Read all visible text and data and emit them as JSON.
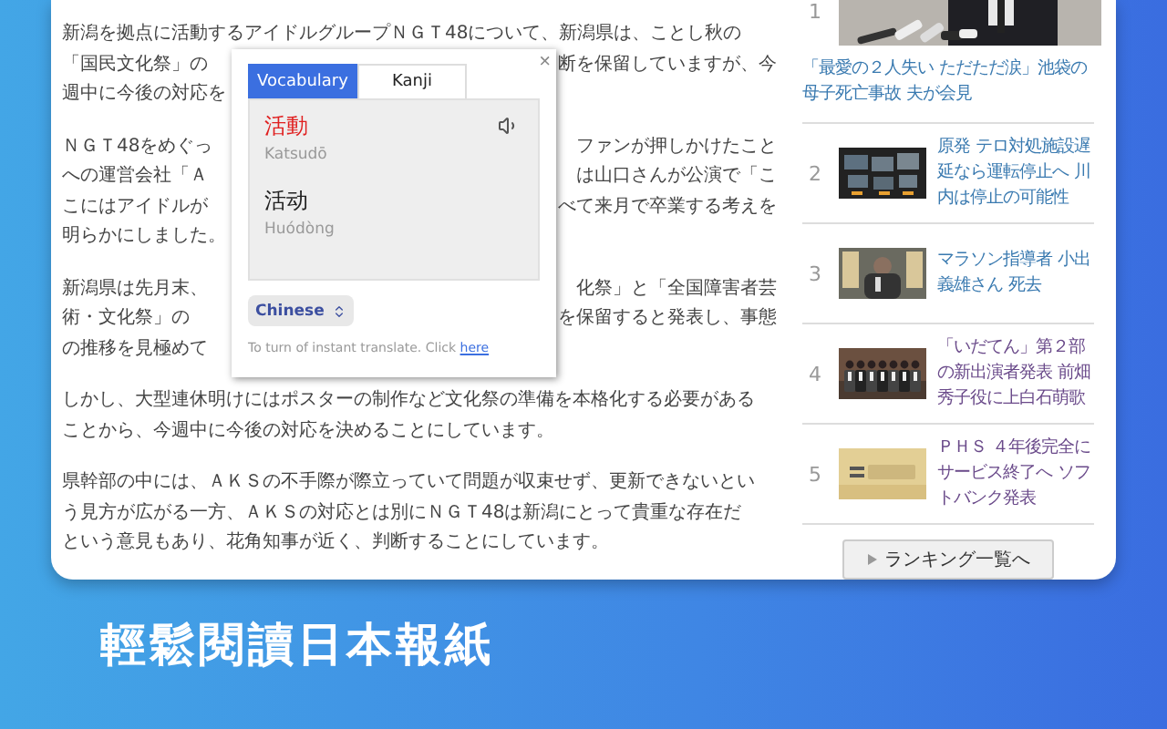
{
  "article": {
    "paragraphs": [
      {
        "lines": [
          {
            "left": "新潟を拠点に活動するアイドルグループＮＧＴ48について、新潟県は、ことし秋の"
          },
          {
            "left": "「国民文化祭」の",
            "right": "断を保留していますが、今"
          },
          {
            "left": "週中に今後の対応を"
          }
        ]
      },
      {
        "lines": [
          {
            "left": "ＮＧＴ48をめぐっ",
            "right": "ファンが押しかけたこと"
          },
          {
            "left": "への運営会社「Ａ",
            "right": "は山口さんが公演で「こ"
          },
          {
            "left": "こにはアイドルが",
            "right": "べて来月で卒業する考えを"
          },
          {
            "left": "明らかにしました。"
          }
        ]
      },
      {
        "lines": [
          {
            "left": "新潟県は先月末、",
            "right": "化祭」と「全国障害者芸"
          },
          {
            "left": "術・文化祭」の",
            "right": "を保留すると発表し、事態"
          },
          {
            "left": "の推移を見極めて"
          }
        ]
      },
      {
        "lines": [
          {
            "left": "しかし、大型連休明けにはポスターの制作など文化祭の準備を本格化する必要がある"
          },
          {
            "left": "ことから、今週中に今後の対応を決めることにしています。"
          }
        ]
      },
      {
        "lines": [
          {
            "left": "県幹部の中には、ＡＫＳの不手際が際立っていて問題が収束せず、更新できないとい"
          },
          {
            "left": "う見方が広がる一方、ＡＫＳの対応とは別にＮＧＴ48は新潟にとって貴重な存在だ"
          },
          {
            "left": "という意見もあり、花角知事が近く、判断することにしています。"
          }
        ]
      }
    ]
  },
  "popup": {
    "close": "×",
    "tabs": [
      {
        "label": "Vocabulary",
        "selected": true
      },
      {
        "label": "Kanji",
        "selected": false
      }
    ],
    "entries": [
      {
        "word": "活動",
        "reading": "Katsudō",
        "kind": "source"
      },
      {
        "word": "活动",
        "reading": "Huódòng",
        "kind": "target"
      }
    ],
    "language": "Chinese",
    "footer": "To turn of instant translate. Click ",
    "footer_link": "here"
  },
  "ranking": {
    "items": [
      {
        "rank": "1",
        "kind": "wide",
        "headline": "「最愛の２人失い ただただ涙」池袋の母子死亡事故 夫が会見"
      },
      {
        "rank": "2",
        "kind": "thumb",
        "headline": "原発 テロ対処施設遅延なら運転停止へ 川内は停止の可能性"
      },
      {
        "rank": "3",
        "kind": "thumb",
        "headline": "マラソン指導者 小出義雄さん 死去"
      },
      {
        "rank": "4",
        "kind": "thumb",
        "headline": "「いだてん」第２部の新出演者発表 前畑秀子役に上白石萌歌"
      },
      {
        "rank": "5",
        "kind": "thumb",
        "headline": "ＰＨＳ ４年後完全にサービス終了へ ソフトバンク発表"
      }
    ],
    "more_button": "ランキング一覧へ"
  },
  "caption": "輕鬆閱讀日本報紙"
}
